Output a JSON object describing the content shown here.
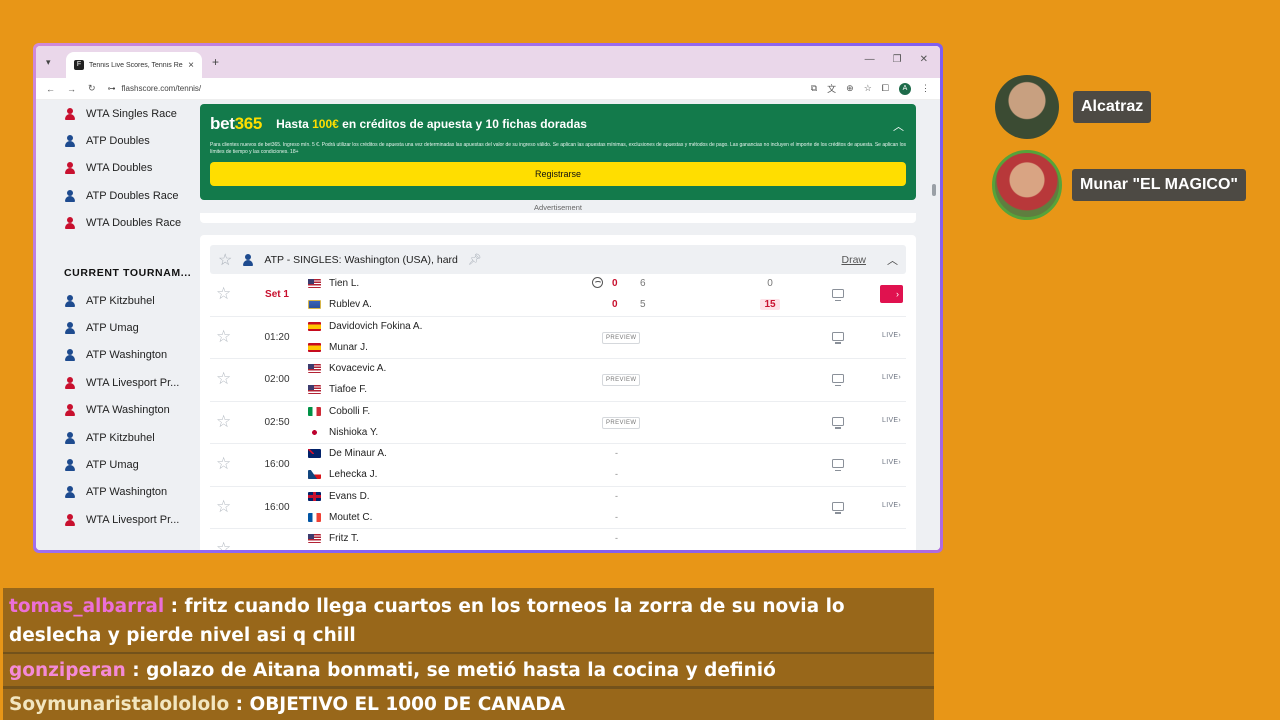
{
  "browser": {
    "tab_title": "Tennis Live Scores, Tennis Results",
    "url": "flashscore.com/tennis/",
    "profile_initial": "A"
  },
  "sidebar": {
    "items_top": [
      {
        "label": "WTA Singles Race",
        "tour": "wta"
      },
      {
        "label": "ATP Doubles",
        "tour": "atp"
      },
      {
        "label": "WTA Doubles",
        "tour": "wta"
      },
      {
        "label": "ATP Doubles Race",
        "tour": "atp"
      },
      {
        "label": "WTA Doubles Race",
        "tour": "wta"
      }
    ],
    "heading": "CURRENT TOURNAM...",
    "items_current": [
      {
        "label": "ATP Kitzbuhel",
        "tour": "atp"
      },
      {
        "label": "ATP Umag",
        "tour": "atp"
      },
      {
        "label": "ATP Washington",
        "tour": "atp"
      },
      {
        "label": "WTA Livesport Pr...",
        "tour": "wta"
      },
      {
        "label": "WTA Washington",
        "tour": "wta"
      },
      {
        "label": "ATP Kitzbuhel",
        "tour": "atp"
      },
      {
        "label": "ATP Umag",
        "tour": "atp"
      },
      {
        "label": "ATP Washington",
        "tour": "atp"
      },
      {
        "label": "WTA Livesport Pr...",
        "tour": "wta"
      }
    ]
  },
  "ad": {
    "logo_main": "bet",
    "logo_num": "365",
    "headline_pre": "Hasta ",
    "headline_amount": "100€",
    "headline_post": " en créditos de apuesta y 10 fichas doradas",
    "fine_print": "Para clientes nuevos de bet365. Ingreso mín. 5 €. Podrá utilizar los créditos de apuesta una vez determinadas las apuestas del valor de su ingreso válido. Se aplican las apuestas mínimas, exclusiones de apuestas y métodos de pago. Las ganancias no incluyen el importe de los créditos de apuesta. Se aplican los límites de tiempo y las condiciones. 18+",
    "cta": "Registrarse",
    "label": "Advertisement"
  },
  "league": {
    "title": "ATP - SINGLES: Washington (USA), hard",
    "draw": "Draw"
  },
  "matches": [
    {
      "time": "Set 1",
      "live": true,
      "p1": "Tien L.",
      "f1": "us",
      "p2": "Rublev A.",
      "f2": "neutral",
      "s1_total": "0",
      "s1_set": "6",
      "s1_pts": "0",
      "s2_total": "0",
      "s2_set": "5",
      "s2_pts": "15"
    },
    {
      "time": "01:20",
      "p1": "Davidovich Fokina A.",
      "f1": "es",
      "p2": "Munar J.",
      "f2": "es",
      "preview": "PREVIEW",
      "live_label": "LIVE"
    },
    {
      "time": "02:00",
      "p1": "Kovacevic A.",
      "f1": "us",
      "p2": "Tiafoe F.",
      "f2": "us",
      "preview": "PREVIEW",
      "live_label": "LIVE"
    },
    {
      "time": "02:50",
      "p1": "Cobolli F.",
      "f1": "it",
      "p2": "Nishioka Y.",
      "f2": "jp",
      "preview": "PREVIEW",
      "live_label": "LIVE"
    },
    {
      "time": "16:00",
      "p1": "De Minaur A.",
      "f1": "au",
      "p2": "Lehecka J.",
      "f2": "cz",
      "dash": "-",
      "live_label": "LIVE"
    },
    {
      "time": "16:00",
      "p1": "Evans D.",
      "f1": "gb",
      "p2": "Moutet C.",
      "f2": "fr",
      "dash": "-",
      "live_label": "LIVE"
    },
    {
      "time": "",
      "p1": "Fritz T.",
      "f1": "us",
      "p2": "",
      "f2": "",
      "dash": "-",
      "live_label": ""
    }
  ],
  "overlay": {
    "streamers": [
      {
        "name": "Alcatraz"
      },
      {
        "name": "Munar \"EL MAGICO\""
      }
    ],
    "chat": [
      {
        "user": "tomas_albarral",
        "message": "fritz cuando llega cuartos en los torneos la zorra de su novia lo deslecha y pierde nivel asi q chill"
      },
      {
        "user": "gonziperan",
        "message": "golazo de Aitana bonmati, se metió hasta la cocina y definió"
      },
      {
        "user": "Soymunaristalolololo",
        "message": "OBJETIVO EL 1000 DE CANADA"
      }
    ]
  },
  "colors": {
    "background": "#e89617",
    "ad_green": "#137a4b",
    "ad_yellow": "#ffde00",
    "live_red": "#c8102e",
    "live_box": "#e0124f"
  }
}
